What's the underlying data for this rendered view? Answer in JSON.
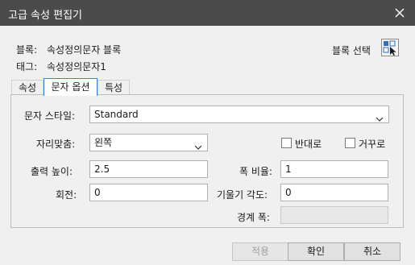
{
  "window": {
    "title": "고급 속성 편집기"
  },
  "header": {
    "block_label": "블록:",
    "block_value": "속성정의문자 블록",
    "tag_label": "태그:",
    "tag_value": "속성정의문자1",
    "select_block_label": "블록 선택",
    "select_block_icon": "select-objects-icon"
  },
  "tabs": [
    {
      "label": "속성",
      "active": false
    },
    {
      "label": "문자 옵션",
      "active": true
    },
    {
      "label": "특성",
      "active": false
    }
  ],
  "text_options": {
    "text_style_label": "문자 스타일:",
    "text_style_value": "Standard",
    "justify_label": "자리맞춤:",
    "justify_value": "왼쪽",
    "backwards_label": "반대로",
    "backwards_checked": false,
    "upside_down_label": "거꾸로",
    "upside_down_checked": false,
    "height_label": "출력 높이:",
    "height_value": "2.5",
    "width_factor_label": "폭 비율:",
    "width_factor_value": "1",
    "rotation_label": "회전:",
    "rotation_value": "0",
    "oblique_label": "기울기 각도:",
    "oblique_value": "0",
    "boundary_width_label": "경계 폭:",
    "boundary_width_value": ""
  },
  "buttons": {
    "apply": "적용",
    "ok": "확인",
    "cancel": "취소"
  }
}
